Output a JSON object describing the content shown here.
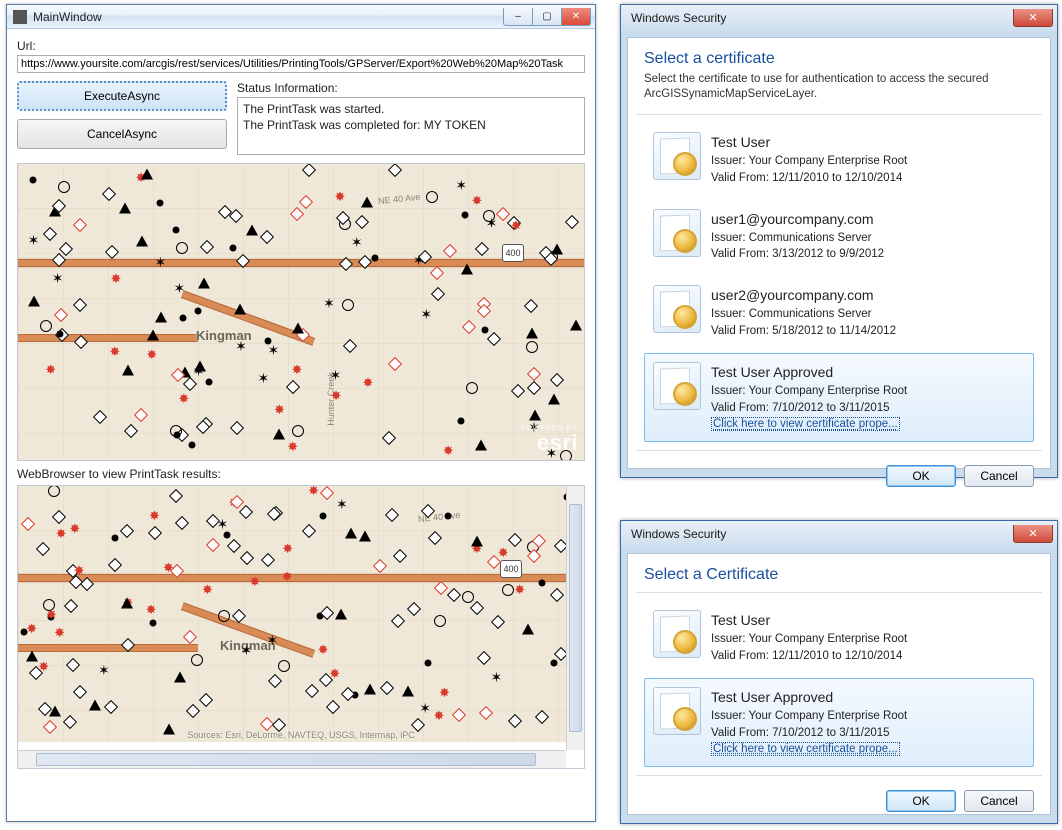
{
  "main_window": {
    "title": "MainWindow",
    "url_label": "Url:",
    "url_value": "https://www.yoursite.com/arcgis/rest/services/Utilities/PrintingTools/GPServer/Export%20Web%20Map%20Task",
    "execute_btn": "ExecuteAsync",
    "cancel_btn": "CancelAsync",
    "status_label": "Status Information:",
    "status_line1": "The PrintTask was started.",
    "status_line2": "The PrintTask was completed for: MY TOKEN",
    "browser_label": "WebBrowser to view PrintTask results:",
    "map": {
      "city": "Kingman",
      "route_shield": "400",
      "street1": "NE 40 Ave",
      "street2": "Hunter Creek",
      "esri_small": "POWERED BY",
      "esri_big": "esri",
      "attribution": "Sources: Esri, DeLorme, NAVTEQ, USGS, Intermap, iPC"
    }
  },
  "sec1": {
    "title": "Windows Security",
    "heading": "Select a certificate",
    "sub": "Select the certificate to use for authentication to access the secured ArcGISSynamicMapServiceLayer.",
    "ok": "OK",
    "cancel": "Cancel",
    "certs": [
      {
        "name": "Test User",
        "issuer": "Issuer: Your Company Enterprise Root",
        "valid": "Valid From: 12/11/2010 to 12/10/2014"
      },
      {
        "name": "user1@yourcompany.com",
        "issuer": "Issuer: Communications Server",
        "valid": "Valid From: 3/13/2012 to 9/9/2012"
      },
      {
        "name": "user2@yourcompany.com",
        "issuer": "Issuer: Communications Server",
        "valid": "Valid From: 5/18/2012 to 11/14/2012"
      },
      {
        "name": "Test User Approved",
        "issuer": "Issuer: Your Company Enterprise Root",
        "valid": "Valid From: 7/10/2012 to 3/11/2015",
        "link": "Click here to view certificate prope..."
      }
    ]
  },
  "sec2": {
    "title": "Windows Security",
    "heading": "Select a Certificate",
    "ok": "OK",
    "cancel": "Cancel",
    "certs": [
      {
        "name": "Test User",
        "issuer": "Issuer: Your Company Enterprise Root",
        "valid": "Valid From: 12/11/2010 to 12/10/2014"
      },
      {
        "name": "Test User Approved",
        "issuer": "Issuer: Your Company Enterprise Root",
        "valid": "Valid From: 7/10/2012 to 3/11/2015",
        "link": "Click here to view certificate prope..."
      }
    ]
  }
}
